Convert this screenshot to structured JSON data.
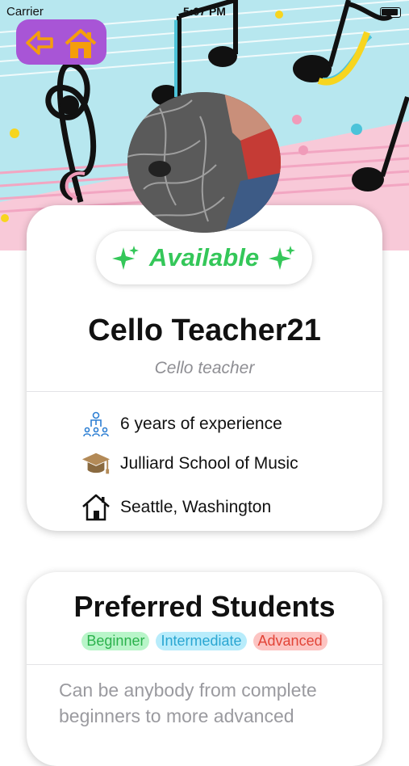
{
  "status_bar": {
    "carrier": "Carrier",
    "time": "5:07 PM"
  },
  "nav": {
    "back_icon": "arrow-left-icon",
    "home_icon": "house-icon"
  },
  "colors": {
    "accent_purple": "#a855d6",
    "available_green": "#34c759",
    "banner_bg": "#b7e7ef"
  },
  "profile": {
    "availability": "Available",
    "name": "Cello Teacher21",
    "role": "Cello teacher",
    "details": [
      {
        "icon": "teacher-students-icon",
        "label": "6 years of experience"
      },
      {
        "icon": "graduation-cap-icon",
        "label": "Julliard School of Music"
      },
      {
        "icon": "house-icon",
        "label": "Seattle, Washington"
      }
    ]
  },
  "preferred": {
    "title": "Preferred Students",
    "tags": [
      "Beginner",
      "Intermediate",
      "Advanced"
    ],
    "description": "Can be anybody from complete beginners to more advanced"
  }
}
